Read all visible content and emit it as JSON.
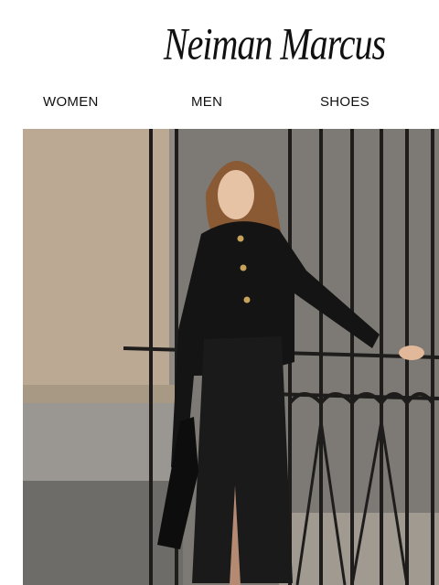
{
  "brand": {
    "logo_text": "Neiman Marcus"
  },
  "nav": {
    "items": [
      {
        "label": "WOMEN"
      },
      {
        "label": "MEN"
      },
      {
        "label": "SHOES"
      }
    ]
  },
  "hero": {
    "image_subject": "woman-in-black-suit-by-iron-gate"
  },
  "colors": {
    "background": "#ffffff",
    "text": "#111111"
  }
}
